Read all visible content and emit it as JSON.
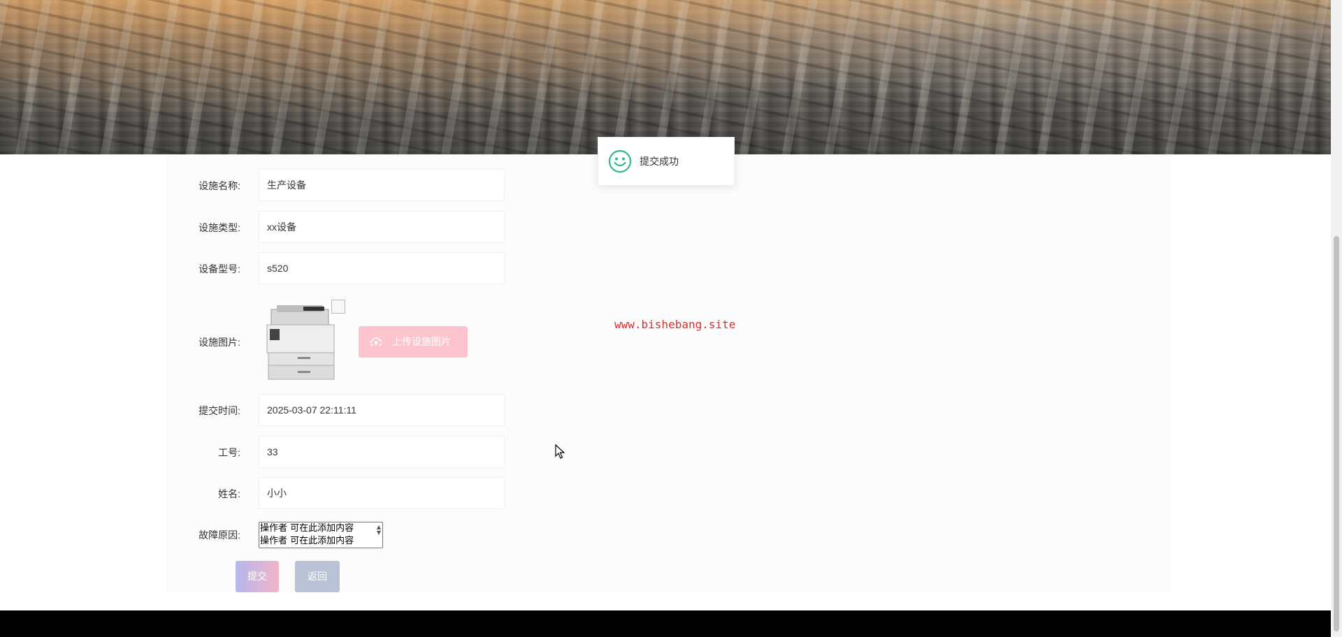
{
  "form": {
    "facility_name": {
      "label": "设施名称:",
      "value": "生产设备"
    },
    "facility_type": {
      "label": "设施类型:",
      "value": "xx设备"
    },
    "device_model": {
      "label": "设备型号:",
      "value": "s520"
    },
    "facility_image": {
      "label": "设施图片:",
      "upload_label": "上传设施图片"
    },
    "submit_time": {
      "label": "提交时间:",
      "value": "2025-03-07 22:11:11"
    },
    "employee_id": {
      "label": "工号:",
      "value": "33"
    },
    "name": {
      "label": "姓名:",
      "value": "小小"
    },
    "fault_reason": {
      "label": "故障原因:",
      "lines": [
        "操作者 可在此添加内容",
        "操作者 可在此添加内容"
      ]
    },
    "submit_label": "提交",
    "back_label": "返回"
  },
  "toast": {
    "message": "提交成功",
    "icon": "smile-icon"
  },
  "watermark": "www.bishebang.site",
  "colors": {
    "upload_button": "#fbc4cf",
    "back_button": "#bac2d6",
    "toast_icon": "#2fb88a",
    "watermark": "#d9302c"
  }
}
